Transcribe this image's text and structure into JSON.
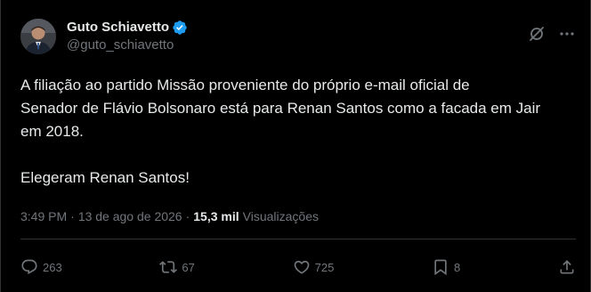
{
  "author": {
    "name": "Guto Schiavetto",
    "handle": "@guto_schiavetto",
    "verified": true,
    "verified_color": "#1d9bf0"
  },
  "header_icons": [
    "grok-icon",
    "more-icon"
  ],
  "tweet": {
    "paragraphs": [
      "A filiação ao partido Missão proveniente do próprio e-mail oficial de\nSenador de Flávio Bolsonaro está para Renan Santos como a facada em Jair\nem 2018.",
      "Elegeram Renan Santos!"
    ]
  },
  "meta": {
    "time": "3:49 PM",
    "date": "13 de ago de 2026",
    "separator": "·",
    "views_count": "15,3 mil",
    "views_label": "Visualizações"
  },
  "actions": {
    "replies": "263",
    "reposts": "67",
    "likes": "725",
    "bookmarks": "8"
  },
  "colors": {
    "background": "#000000",
    "text": "#e7e9ea",
    "secondary": "#71767b",
    "border": "#2f3336"
  }
}
